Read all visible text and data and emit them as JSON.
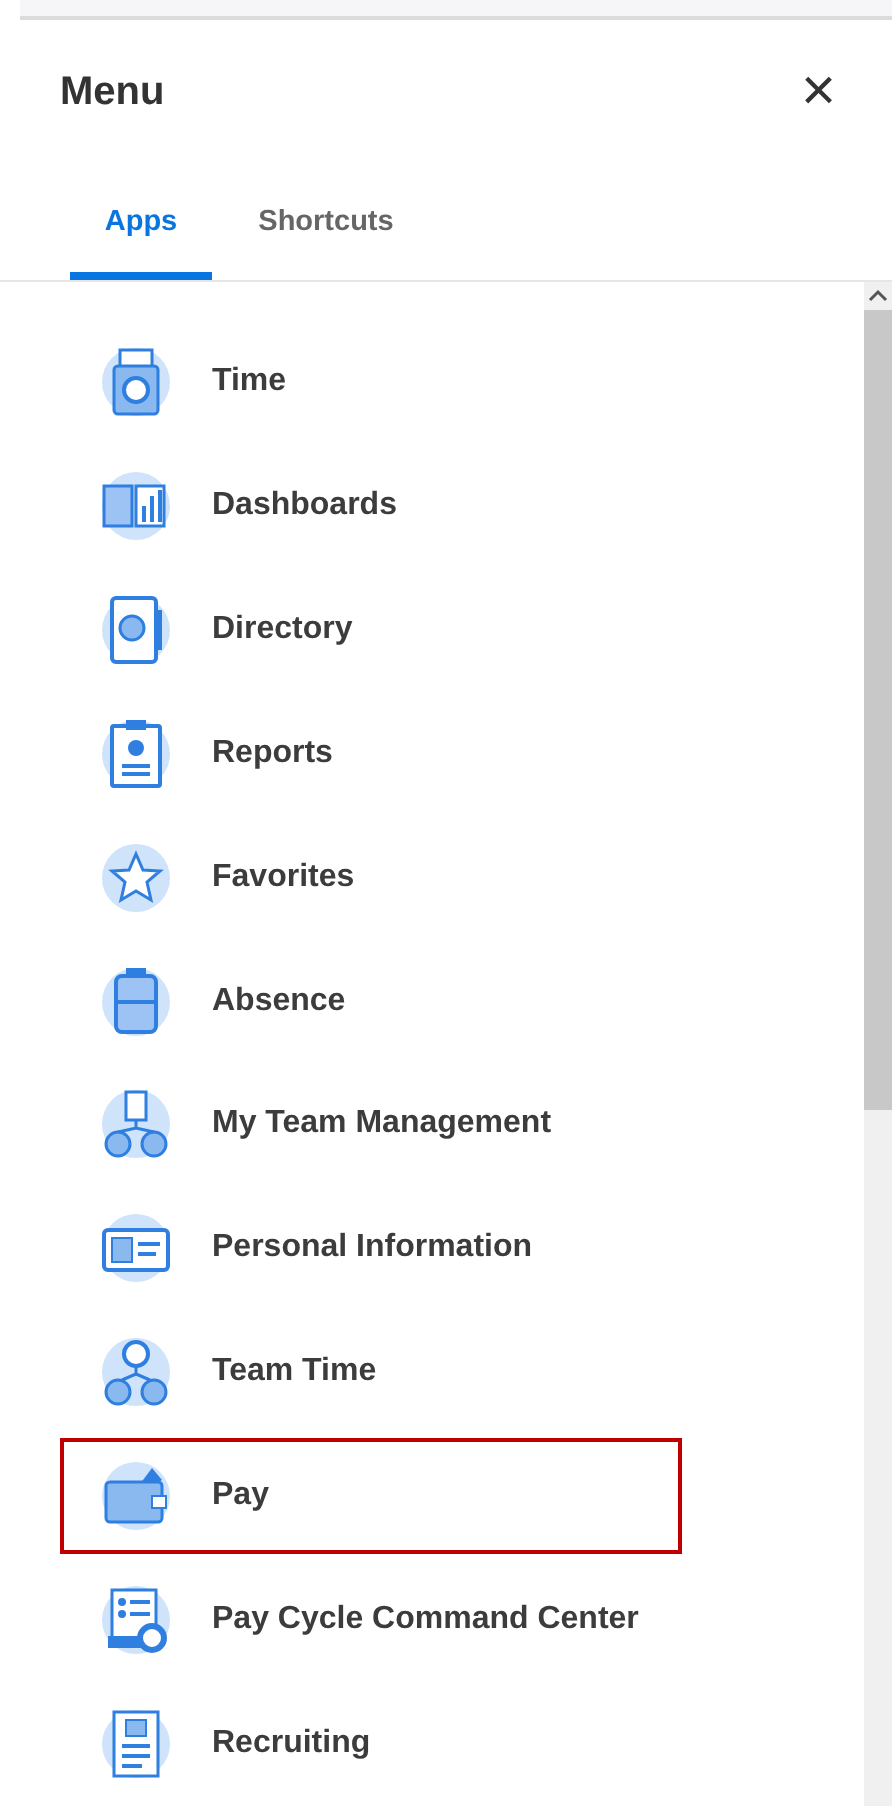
{
  "header": {
    "title": "Menu",
    "close": "×"
  },
  "tabs": [
    {
      "label": "Apps",
      "selected": true
    },
    {
      "label": "Shortcuts",
      "selected": false
    }
  ],
  "apps": [
    {
      "label": "Time",
      "highlighted": false
    },
    {
      "label": "Dashboards",
      "highlighted": false
    },
    {
      "label": "Directory",
      "highlighted": false
    },
    {
      "label": "Reports",
      "highlighted": false
    },
    {
      "label": "Favorites",
      "highlighted": false
    },
    {
      "label": "Absence",
      "highlighted": false
    },
    {
      "label": "My Team Management",
      "highlighted": false
    },
    {
      "label": "Personal Information",
      "highlighted": false
    },
    {
      "label": "Team Time",
      "highlighted": false
    },
    {
      "label": "Pay",
      "highlighted": true
    },
    {
      "label": "Pay Cycle Command Center",
      "highlighted": false
    },
    {
      "label": "Recruiting",
      "highlighted": false
    }
  ]
}
